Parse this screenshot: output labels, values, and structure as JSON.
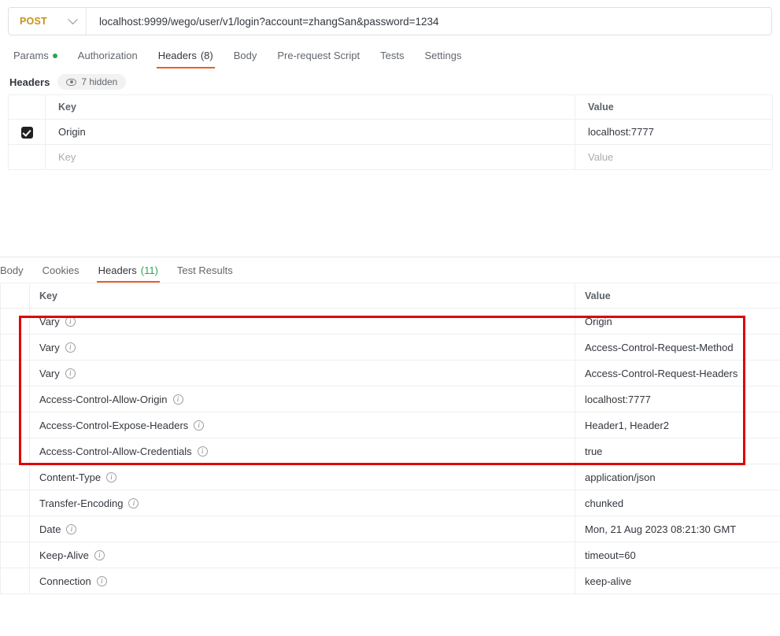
{
  "request": {
    "method": {
      "label": "POST",
      "icon": "chevron-down-icon"
    },
    "url": "localhost:9999/wego/user/v1/login?account=zhangSan&password=1234",
    "tabs": [
      {
        "label": "Params",
        "indicator": "dot",
        "active": false
      },
      {
        "label": "Authorization",
        "active": false
      },
      {
        "label": "Headers",
        "count": "(8)",
        "active": true
      },
      {
        "label": "Body",
        "active": false
      },
      {
        "label": "Pre-request Script",
        "active": false
      },
      {
        "label": "Tests",
        "active": false
      },
      {
        "label": "Settings",
        "active": false
      }
    ],
    "section_title": "Headers",
    "hidden_badge": {
      "icon": "eye-icon",
      "label": "7 hidden"
    },
    "table": {
      "columns": [
        "Key",
        "Value"
      ],
      "rows": [
        {
          "checked": true,
          "key": "Origin",
          "value": "localhost:7777"
        }
      ],
      "placeholder_row": {
        "key": "Key",
        "value": "Value"
      }
    }
  },
  "response": {
    "tabs": [
      {
        "label": "Body",
        "active": false
      },
      {
        "label": "Cookies",
        "active": false
      },
      {
        "label": "Headers",
        "count": "(11)",
        "active": true
      },
      {
        "label": "Test Results",
        "active": false
      }
    ],
    "table": {
      "columns": [
        "Key",
        "Value"
      ],
      "rows": [
        {
          "key": "Vary",
          "value": "Origin",
          "highlighted": true
        },
        {
          "key": "Vary",
          "value": "Access-Control-Request-Method",
          "highlighted": true
        },
        {
          "key": "Vary",
          "value": "Access-Control-Request-Headers",
          "highlighted": true
        },
        {
          "key": "Access-Control-Allow-Origin",
          "value": "localhost:7777",
          "highlighted": true
        },
        {
          "key": "Access-Control-Expose-Headers",
          "value": "Header1, Header2",
          "highlighted": true
        },
        {
          "key": "Access-Control-Allow-Credentials",
          "value": "true",
          "highlighted": true
        },
        {
          "key": "Content-Type",
          "value": "application/json",
          "highlighted": false
        },
        {
          "key": "Transfer-Encoding",
          "value": "chunked",
          "highlighted": false
        },
        {
          "key": "Date",
          "value": "Mon, 21 Aug 2023 08:21:30 GMT",
          "highlighted": false
        },
        {
          "key": "Keep-Alive",
          "value": "timeout=60",
          "highlighted": false
        },
        {
          "key": "Connection",
          "value": "keep-alive",
          "highlighted": false
        }
      ]
    },
    "annotation": {
      "type": "rectangle-highlight",
      "color": "#e00000"
    }
  },
  "colors": {
    "accent": "#ef5b25",
    "method": "#c7921a",
    "success": "#2aa653",
    "highlight": "#e00000"
  }
}
